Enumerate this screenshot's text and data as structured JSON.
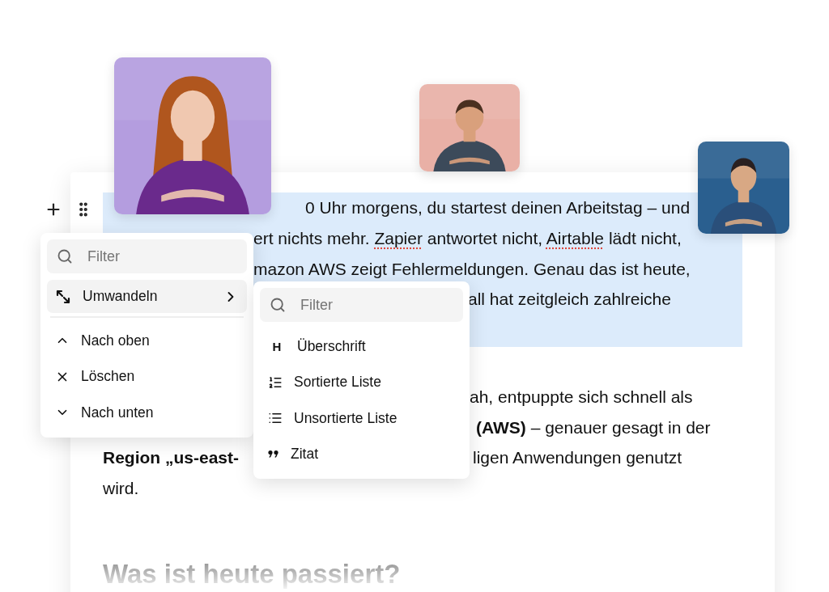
{
  "editor": {
    "paragraphs": [
      {
        "highlighted": true,
        "lines": [
          {
            "runs": [
              {
                "parts": [
                  {
                    "text": "0 Uhr morgens, du startest deinen Arbeitstag – und",
                    "bold": false,
                    "misspelled": false
                  }
                ]
              }
            ]
          },
          {
            "runs": [
              {
                "parts": [
                  {
                    "text": "ert nichts mehr. ",
                    "bold": false,
                    "misspelled": false
                  },
                  {
                    "text": "Zapier",
                    "bold": false,
                    "misspelled": true
                  },
                  {
                    "text": " antwortet nicht, ",
                    "bold": false,
                    "misspelled": false
                  },
                  {
                    "text": "Airtable",
                    "bold": false,
                    "misspelled": true
                  },
                  {
                    "text": " lädt nicht,",
                    "bold": false,
                    "misspelled": false
                  }
                ]
              }
            ]
          },
          {
            "runs": [
              {
                "parts": [
                  {
                    "text": "mazon AWS zeigt Fehlermeldungen. Genau das ist heute,",
                    "bold": false,
                    "misspelled": false
                  }
                ]
              }
            ]
          },
          {
            "runs": [
              {
                "parts": [
                  {
                    "text": "all hat zeitgleich zahlreiche",
                    "bold": false,
                    "misspelled": false
                  }
                ]
              }
            ]
          }
        ]
      },
      {
        "highlighted": false,
        "lines": [
          {
            "runs": [
              {
                "parts": [
                  {
                    "text": "ah, entpuppte sich schnell als",
                    "bold": false,
                    "misspelled": false
                  }
                ]
              }
            ]
          },
          {
            "runs": [
              {
                "parts": [
                  {
                    "text": "(AWS)",
                    "bold": true,
                    "misspelled": false
                  },
                  {
                    "text": " – genauer gesagt in der",
                    "bold": false,
                    "misspelled": false
                  }
                ]
              }
            ]
          },
          {
            "runs": [
              {
                "parts": [
                  {
                    "text": "Region „us-east-",
                    "bold": true,
                    "misspelled": false
                  }
                ]
              },
              {
                "parts": [
                  {
                    "text": "ligen Anwendungen genutzt",
                    "bold": false,
                    "misspelled": false
                  }
                ]
              }
            ]
          },
          {
            "runs": [
              {
                "parts": [
                  {
                    "text": "wird.",
                    "bold": false,
                    "misspelled": false
                  }
                ]
              }
            ]
          }
        ]
      }
    ],
    "heading": "Was ist heute passiert?"
  },
  "block_menu": {
    "filter": {
      "placeholder": "Filter"
    },
    "items": [
      {
        "kind": "convert",
        "label": "Umwandeln",
        "selected": true,
        "has_submenu": true
      },
      {
        "kind": "separator"
      },
      {
        "kind": "up",
        "label": "Nach oben",
        "selected": false,
        "has_submenu": false
      },
      {
        "kind": "delete",
        "label": "Löschen",
        "selected": false,
        "has_submenu": false
      },
      {
        "kind": "down",
        "label": "Nach unten",
        "selected": false,
        "has_submenu": false
      }
    ]
  },
  "submenu": {
    "filter": {
      "placeholder": "Filter"
    },
    "items": [
      {
        "kind": "heading",
        "glyph": "H",
        "label": "Überschrift"
      },
      {
        "kind": "ordered",
        "label": "Sortierte Liste"
      },
      {
        "kind": "bullet",
        "label": "Unsortierte Liste"
      },
      {
        "kind": "quote",
        "label": "Zitat"
      }
    ]
  }
}
